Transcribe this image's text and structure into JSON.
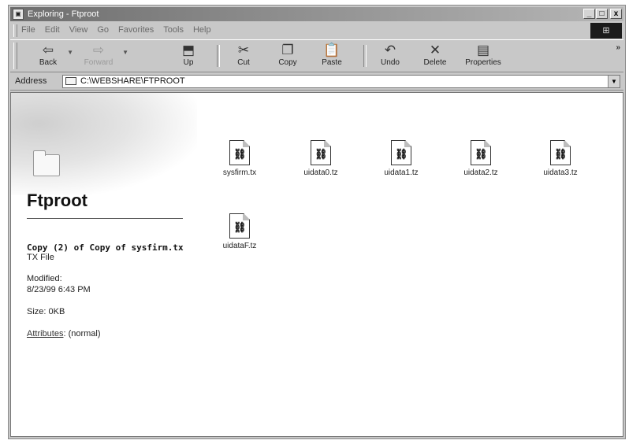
{
  "window": {
    "title": "Exploring - Ftproot",
    "app_icon": "explorer-icon",
    "caption_buttons": [
      "_",
      "□",
      "x"
    ]
  },
  "menubar": {
    "items": [
      "File",
      "Edit",
      "View",
      "Go",
      "Favorites",
      "Tools",
      "Help"
    ]
  },
  "toolbar": {
    "buttons": [
      {
        "label": "Back",
        "icon": "back-arrow-icon",
        "glyph": "⇦",
        "enabled": true
      },
      {
        "label": "Forward",
        "icon": "forward-arrow-icon",
        "glyph": "⇨",
        "enabled": false
      },
      {
        "label": "Up",
        "icon": "up-folder-icon",
        "glyph": "⬒",
        "enabled": true
      },
      {
        "label": "Cut",
        "icon": "cut-icon",
        "glyph": "✂",
        "enabled": true
      },
      {
        "label": "Copy",
        "icon": "copy-icon",
        "glyph": "❐",
        "enabled": true
      },
      {
        "label": "Paste",
        "icon": "paste-icon",
        "glyph": "📋",
        "enabled": true
      },
      {
        "label": "Undo",
        "icon": "undo-icon",
        "glyph": "↶",
        "enabled": true
      },
      {
        "label": "Delete",
        "icon": "delete-icon",
        "glyph": "✕",
        "enabled": true
      },
      {
        "label": "Properties",
        "icon": "properties-icon",
        "glyph": "▤",
        "enabled": true
      }
    ],
    "more": "»"
  },
  "address": {
    "label": "Address",
    "path": "C:\\WEBSHARE\\FTPROOT"
  },
  "folder_panel": {
    "name": "Ftproot",
    "selected_file": "Copy (2) of Copy of sysfirm.tx",
    "file_type": "TX File",
    "modified_label": "Modified:",
    "modified_value": "8/23/99 6:43 PM",
    "size": "Size: 0KB",
    "attributes_link": "Attributes",
    "attributes_value": ": (normal)"
  },
  "files": [
    {
      "name": "sysfirm.tx"
    },
    {
      "name": "uidata0.tz"
    },
    {
      "name": "uidata1.tz"
    },
    {
      "name": "uidata2.tz"
    },
    {
      "name": "uidata3.tz"
    },
    {
      "name": "uidataF.tz"
    }
  ],
  "brand": {
    "logo": "⊞"
  }
}
